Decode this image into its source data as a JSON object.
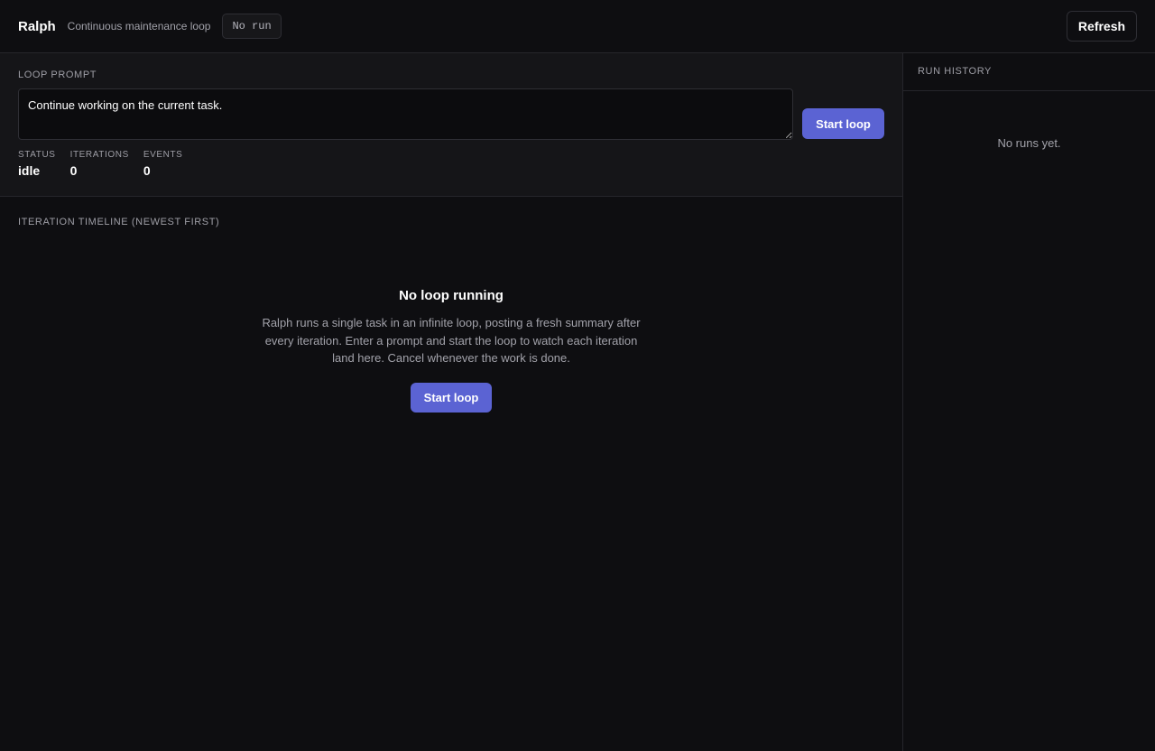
{
  "header": {
    "app_name": "Ralph",
    "subtitle": "Continuous maintenance loop",
    "run_badge": "No run",
    "refresh_label": "Refresh"
  },
  "prompt": {
    "section_label": "LOOP PROMPT",
    "value": "Continue working on the current task.",
    "start_label": "Start loop"
  },
  "stats": {
    "status_label": "STATUS",
    "status_value": "idle",
    "iterations_label": "ITERATIONS",
    "iterations_value": "0",
    "events_label": "EVENTS",
    "events_value": "0"
  },
  "timeline": {
    "section_label": "ITERATION TIMELINE (NEWEST FIRST)",
    "empty_title": "No loop running",
    "empty_description": "Ralph runs a single task in an infinite loop, posting a fresh summary after every iteration. Enter a prompt and start the loop to watch each iteration land here. Cancel whenever the work is done.",
    "start_label": "Start loop"
  },
  "sidebar": {
    "title": "RUN HISTORY",
    "empty_text": "No runs yet."
  },
  "colors": {
    "accent": "#5b63d3",
    "background": "#0e0e11",
    "panel": "#151518"
  }
}
